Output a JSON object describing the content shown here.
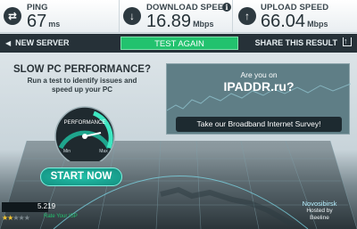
{
  "stats": {
    "ping": {
      "label": "PING",
      "value": "67",
      "unit": "ms"
    },
    "download": {
      "label": "DOWNLOAD SPEED",
      "value": "16.89",
      "unit": "Mbps"
    },
    "upload": {
      "label": "UPLOAD SPEED",
      "value": "66.04",
      "unit": "Mbps"
    }
  },
  "actions": {
    "new_server": "NEW SERVER",
    "test_again": "TEST AGAIN",
    "share": "SHARE THIS RESULT"
  },
  "promo": {
    "title": "SLOW PC PERFORMANCE?",
    "subtitle": "Run a test to identify issues and speed up your PC",
    "gauge_label": "PERFORMANCE",
    "gauge_min": "Min",
    "gauge_max": "Max"
  },
  "ad": {
    "question": "Are you on",
    "brand": "IPADDR.ru?",
    "cta": "Take our Broadband Internet Survey!"
  },
  "start_button": "START NOW",
  "isp": {
    "ip_suffix": "5.219",
    "rate_label": "Rate Your ISP",
    "stars_filled": 2,
    "stars_total": 5
  },
  "host": {
    "city": "Novosibirsk",
    "hosted_by": "Hosted by",
    "name": "Beeline"
  },
  "colors": {
    "accent_green": "#22c26e",
    "dark_bar": "#263138",
    "start_teal": "#23c1a9"
  }
}
